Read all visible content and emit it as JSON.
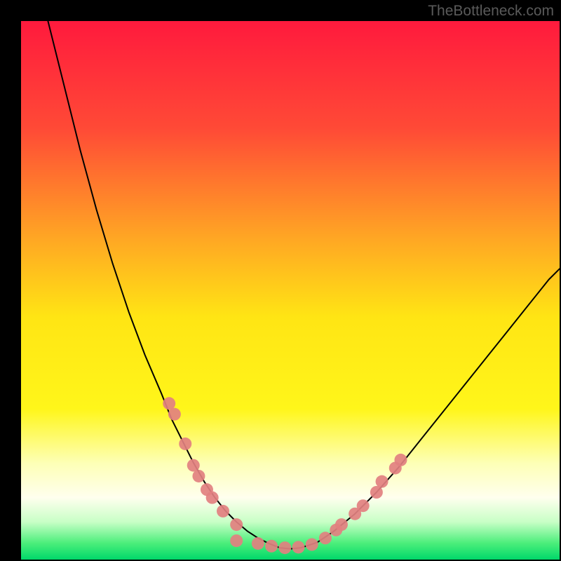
{
  "watermark": "TheBottleneck.com",
  "chart_data": {
    "type": "line",
    "title": "",
    "xlabel": "",
    "ylabel": "",
    "xlim": [
      0,
      100
    ],
    "ylim": [
      0,
      100
    ],
    "background_gradient": {
      "stops": [
        {
          "offset": 0.0,
          "color": "#ff1a3d"
        },
        {
          "offset": 0.2,
          "color": "#ff4a36"
        },
        {
          "offset": 0.4,
          "color": "#ffa524"
        },
        {
          "offset": 0.55,
          "color": "#ffe514"
        },
        {
          "offset": 0.72,
          "color": "#fff61a"
        },
        {
          "offset": 0.82,
          "color": "#fdffb5"
        },
        {
          "offset": 0.885,
          "color": "#ffffee"
        },
        {
          "offset": 0.93,
          "color": "#c8ffc6"
        },
        {
          "offset": 0.97,
          "color": "#4aee7a"
        },
        {
          "offset": 1.0,
          "color": "#00d86a"
        }
      ]
    },
    "series": [
      {
        "name": "bottleneck-curve",
        "type": "line",
        "color": "#000000",
        "width": 2,
        "x": [
          5.0,
          8,
          11,
          14,
          17,
          20,
          23,
          26,
          28,
          30,
          32,
          34,
          36,
          38,
          40,
          42,
          44,
          46,
          48,
          50,
          52,
          55,
          58,
          62,
          66,
          70,
          74,
          78,
          82,
          86,
          90,
          94,
          98,
          100
        ],
        "y": [
          100,
          88,
          76,
          65,
          55,
          46,
          38,
          31,
          26,
          22,
          18,
          14.5,
          11.5,
          9,
          7,
          5.3,
          4,
          3,
          2.2,
          2,
          2.2,
          3.2,
          5.2,
          8.5,
          12.5,
          17,
          22,
          27,
          32,
          37,
          42,
          47,
          52,
          54
        ]
      },
      {
        "name": "left-markers",
        "type": "scatter",
        "color": "#e28080",
        "radius": 9,
        "x": [
          27.5,
          28.5,
          30.5,
          32.0,
          33.0,
          34.5,
          35.5,
          37.5,
          40.0,
          40.0
        ],
        "y": [
          29.0,
          27.0,
          21.5,
          17.5,
          15.5,
          13.0,
          11.5,
          9.0,
          6.5,
          3.5
        ]
      },
      {
        "name": "right-markers",
        "type": "scatter",
        "color": "#e28080",
        "radius": 9,
        "x": [
          56.5,
          58.5,
          59.5,
          62.0,
          63.5,
          66.0,
          67.0,
          69.5,
          70.5
        ],
        "y": [
          4.0,
          5.5,
          6.5,
          8.5,
          10.0,
          12.5,
          14.5,
          17.0,
          18.5
        ]
      },
      {
        "name": "bottom-markers",
        "type": "scatter",
        "color": "#e28080",
        "radius": 9,
        "x": [
          44.0,
          46.5,
          49.0,
          51.5,
          54.0
        ],
        "y": [
          3.0,
          2.5,
          2.2,
          2.3,
          2.8
        ]
      }
    ]
  }
}
